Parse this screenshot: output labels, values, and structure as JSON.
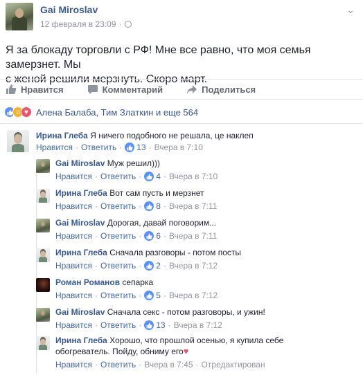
{
  "post": {
    "author": "Gai Miroslav",
    "timestamp": "12 февраля в 23:09",
    "text_line1": "Я за блокаду торговли с РФ! Мне все равно, что моя семья замерзнет. Мы",
    "text_line2": "с женой решили мерзнуть. Скоро март."
  },
  "actions": {
    "like": "Нравится",
    "comment": "Комментарий",
    "share": "Поделиться"
  },
  "reactions": {
    "names": "Алена Балаба, Тим Златкин и еще 564",
    "types": [
      "like",
      "haha",
      "love"
    ]
  },
  "comment_actions": {
    "like": "Нравится",
    "reply": "Ответить",
    "edited": "Отредактирован"
  },
  "comments": [
    {
      "author": "Ирина Глеба",
      "text": "Я ничего подобного не решала, це наклеп",
      "likes": "13",
      "time": "Вчера в 7:10"
    },
    {
      "author": "Gai Miroslav",
      "text": "Муж решил)))",
      "likes": "4",
      "time": "Вчера в 7:10"
    },
    {
      "author": "Ирина Глеба",
      "text": "Вот сам пусть и мерзнет",
      "likes": "8",
      "time": "Вчера в 7:11"
    },
    {
      "author": "Gai Miroslav",
      "text": "Дорогая, давай поговорим...",
      "likes": "6",
      "time": "Вчера в 7:11"
    },
    {
      "author": "Ирина Глеба",
      "text": "Сначала разговоры - потом посты",
      "likes": "2",
      "time": "Вчера в 7:12"
    },
    {
      "author": "Роман Романов",
      "text": "сепарка",
      "likes": "5",
      "time": "Вчера в 7:12"
    },
    {
      "author": "Gai Miroslav",
      "text": "Сначала секс - потом разговоры, и ужин!",
      "likes": "13",
      "time": "Вчера в 7:12"
    },
    {
      "author": "Ирина Глеба",
      "text_line1": "Хорошо, что прошлой осенью, я купила себе",
      "text_line2": "обогреватель. Пойду, обниму его",
      "time": "Вчера в 7:45"
    }
  ],
  "colors": {
    "link_blue": "#365899",
    "action_blue": "#4267b2",
    "meta_gray": "#90949c",
    "like_blue": "#5890ff"
  }
}
